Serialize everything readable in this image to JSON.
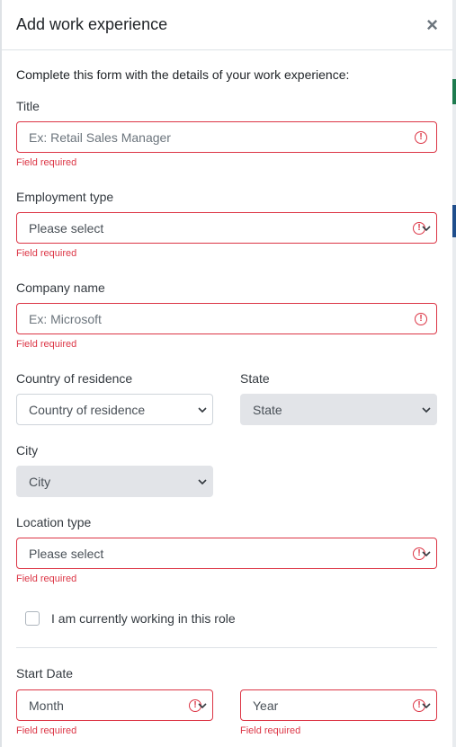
{
  "modal": {
    "title": "Add work experience",
    "close_icon": "×",
    "intro": "Complete this form with the details of your work experience:"
  },
  "fields": {
    "title": {
      "label": "Title",
      "placeholder": "Ex: Retail Sales Manager",
      "error": "Field required"
    },
    "employment_type": {
      "label": "Employment type",
      "value": "Please select",
      "error": "Field required"
    },
    "company_name": {
      "label": "Company name",
      "placeholder": "Ex: Microsoft",
      "error": "Field required"
    },
    "country": {
      "label": "Country of residence",
      "value": "Country of residence"
    },
    "state": {
      "label": "State",
      "value": "State"
    },
    "city": {
      "label": "City",
      "value": "City"
    },
    "location_type": {
      "label": "Location type",
      "value": "Please select",
      "error": "Field required"
    },
    "currently_working": {
      "label": "I am currently working in this role",
      "checked": false
    },
    "start_date": {
      "label": "Start Date",
      "month": {
        "value": "Month",
        "error": "Field required"
      },
      "year": {
        "value": "Year",
        "error": "Field required"
      }
    }
  },
  "icons": {
    "error": "!",
    "error_icon_name": "exclamation-circle-icon",
    "chevron_icon_name": "chevron-down-icon"
  },
  "colors": {
    "error": "#dc3545",
    "disabled_bg": "#e2e4e8",
    "border": "#ced4da"
  }
}
